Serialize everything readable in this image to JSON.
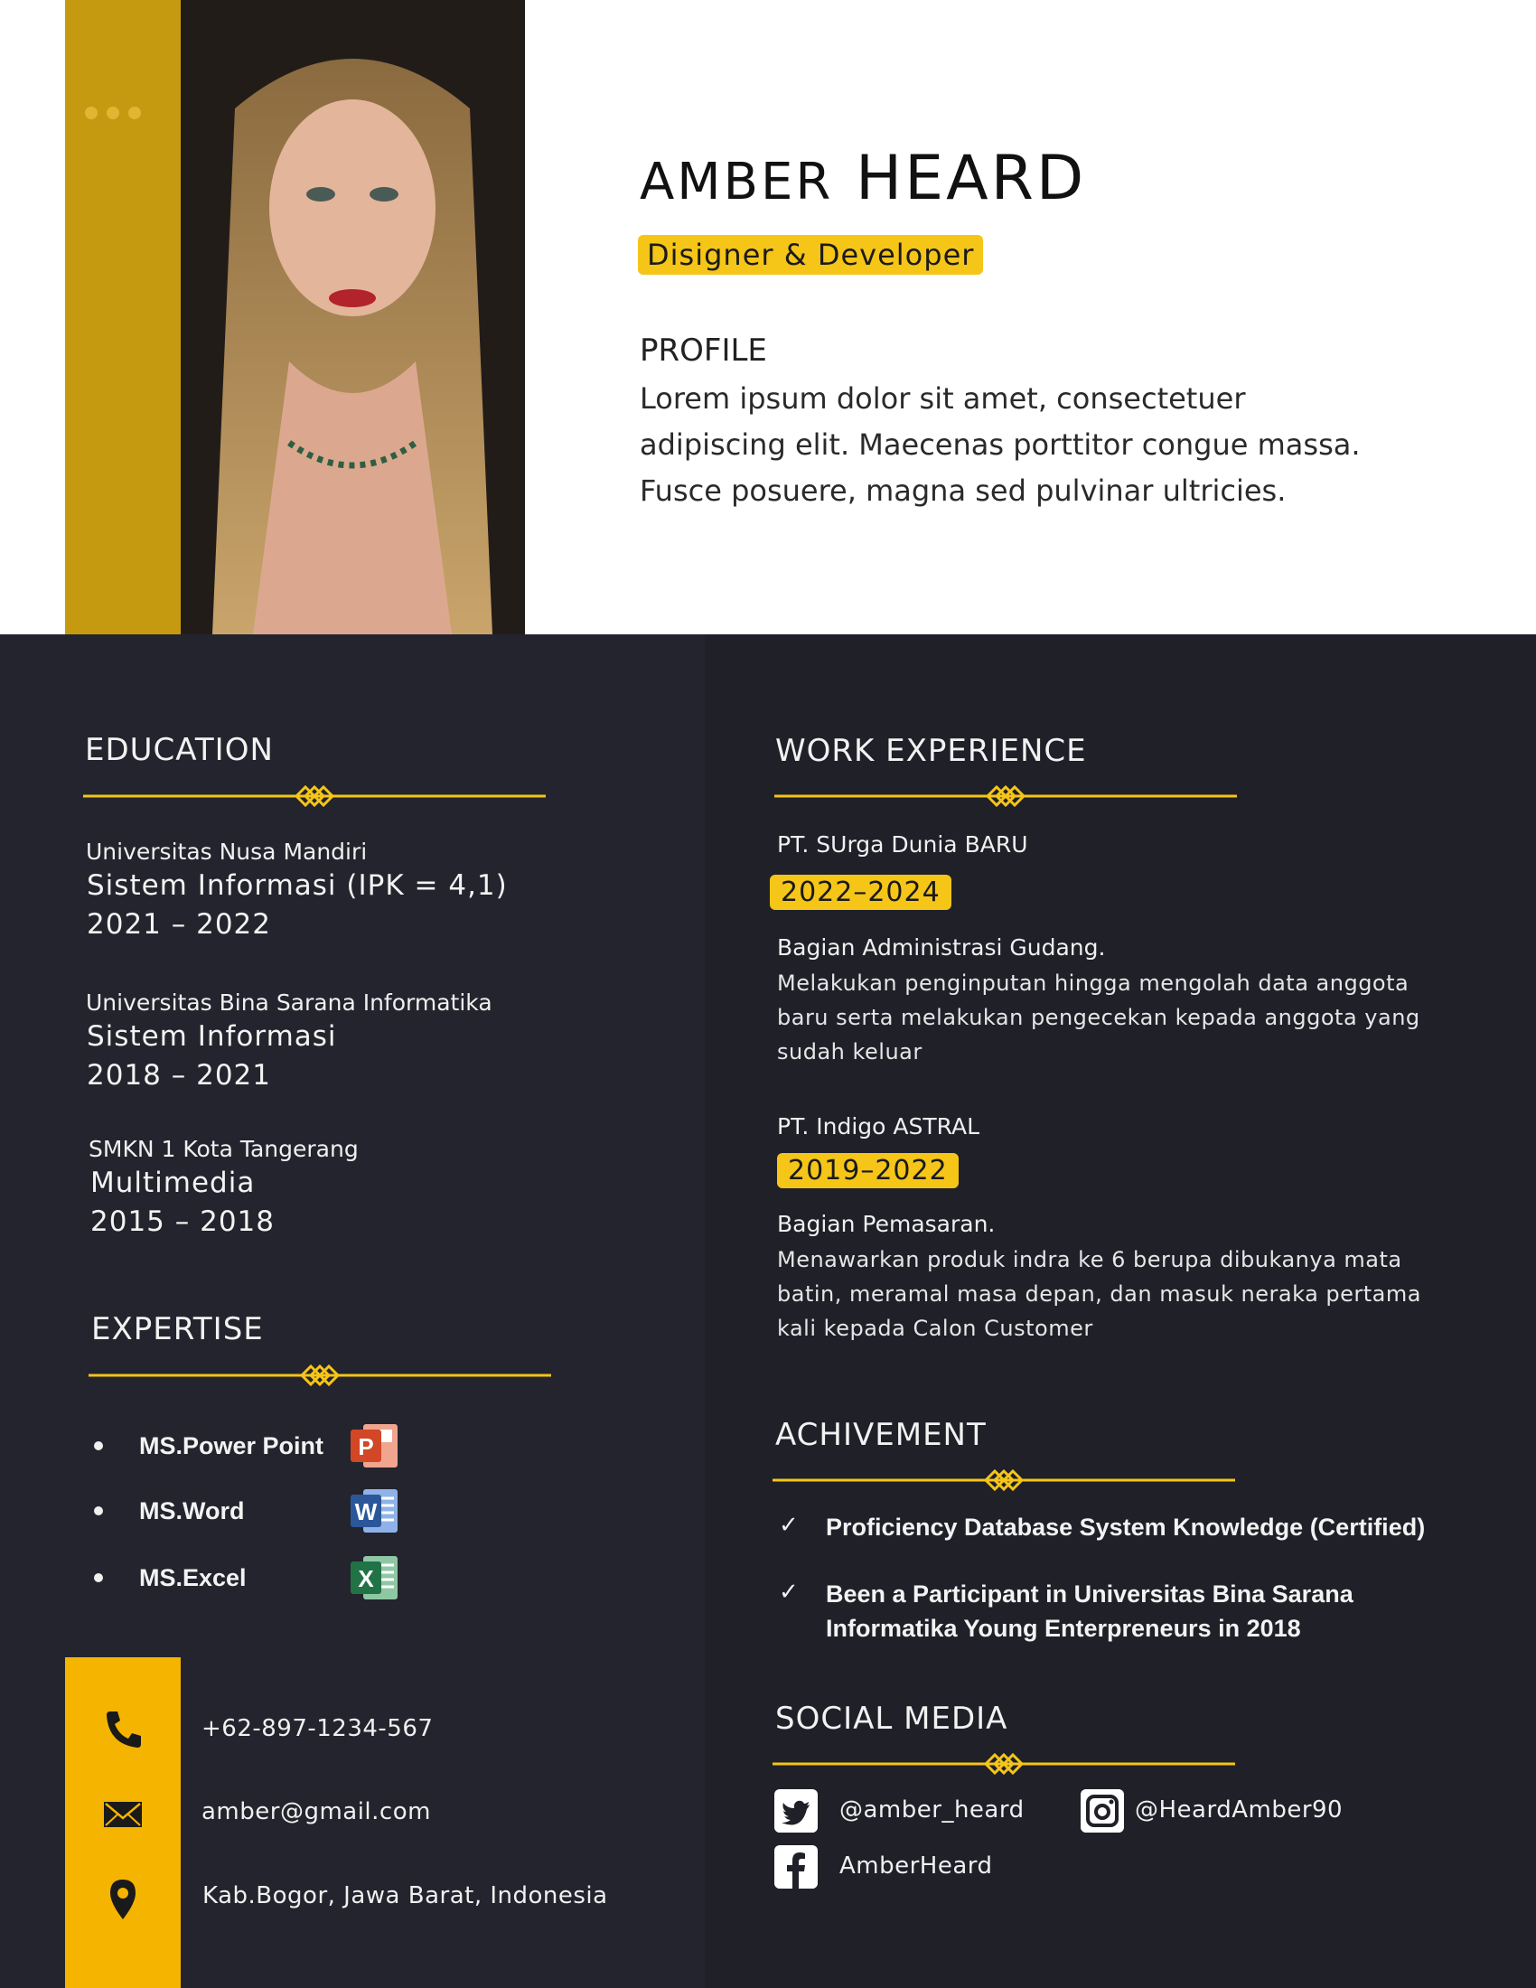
{
  "header": {
    "first_name": "AMBER",
    "last_name": "HEARD",
    "role": "Disigner & Developer",
    "profile_title": "PROFILE",
    "profile_text": "Lorem ipsum dolor sit amet, consectetuer adipiscing elit. Maecenas porttitor congue massa. Fusce posuere, magna sed pulvinar ultricies."
  },
  "education": {
    "title": "EDUCATION",
    "items": [
      {
        "school": "Universitas Nusa Mandiri",
        "major": "Sistem Informasi (IPK = 4,1)",
        "years": "2021 – 2022"
      },
      {
        "school": "Universitas Bina Sarana Informatika",
        "major": "Sistem Informasi",
        "years": "2018 – 2021"
      },
      {
        "school": "SMKN 1 Kota Tangerang",
        "major": "Multimedia",
        "years": "2015 – 2018"
      }
    ]
  },
  "expertise": {
    "title": "EXPERTISE",
    "items": [
      {
        "label": "MS.Power Point",
        "icon": "powerpoint-icon",
        "color": "#d24726",
        "letter": "P"
      },
      {
        "label": "MS.Word",
        "icon": "word-icon",
        "color": "#2b579a",
        "letter": "W"
      },
      {
        "label": "MS.Excel",
        "icon": "excel-icon",
        "color": "#217346",
        "letter": "X"
      }
    ]
  },
  "contact": {
    "phone": "+62-897-1234-567",
    "email": "amber@gmail.com",
    "address": "Kab.Bogor, Jawa Barat, Indonesia"
  },
  "work": {
    "title": "WORK EXPERIENCE",
    "items": [
      {
        "company": "PT. SUrga Dunia BARU",
        "years": "2022–2024",
        "position": "Bagian Administrasi Gudang.",
        "desc": "Melakukan penginputan hingga mengolah data anggota baru serta melakukan pengecekan kepada anggota yang sudah keluar"
      },
      {
        "company": "PT. Indigo ASTRAL",
        "years": "2019–2022",
        "position": "Bagian Pemasaran.",
        "desc": "Menawarkan produk indra ke 6 berupa dibukanya mata batin, meramal masa depan, dan masuk neraka pertama kali kepada Calon Customer"
      }
    ]
  },
  "achievement": {
    "title": "ACHIVEMENT",
    "items": [
      "Proficiency Database System Knowledge (Certified)",
      "Been a Participant in Universitas Bina Sarana Informatika Young Enterpreneurs in 2018"
    ]
  },
  "social": {
    "title": "SOCIAL MEDIA",
    "twitter": "@amber_heard",
    "instagram": "@HeardAmber90",
    "facebook": "AmberHeard"
  },
  "colors": {
    "accent": "#f5c518",
    "dark_bg": "#23242d",
    "accent_bar": "#c69a10"
  }
}
